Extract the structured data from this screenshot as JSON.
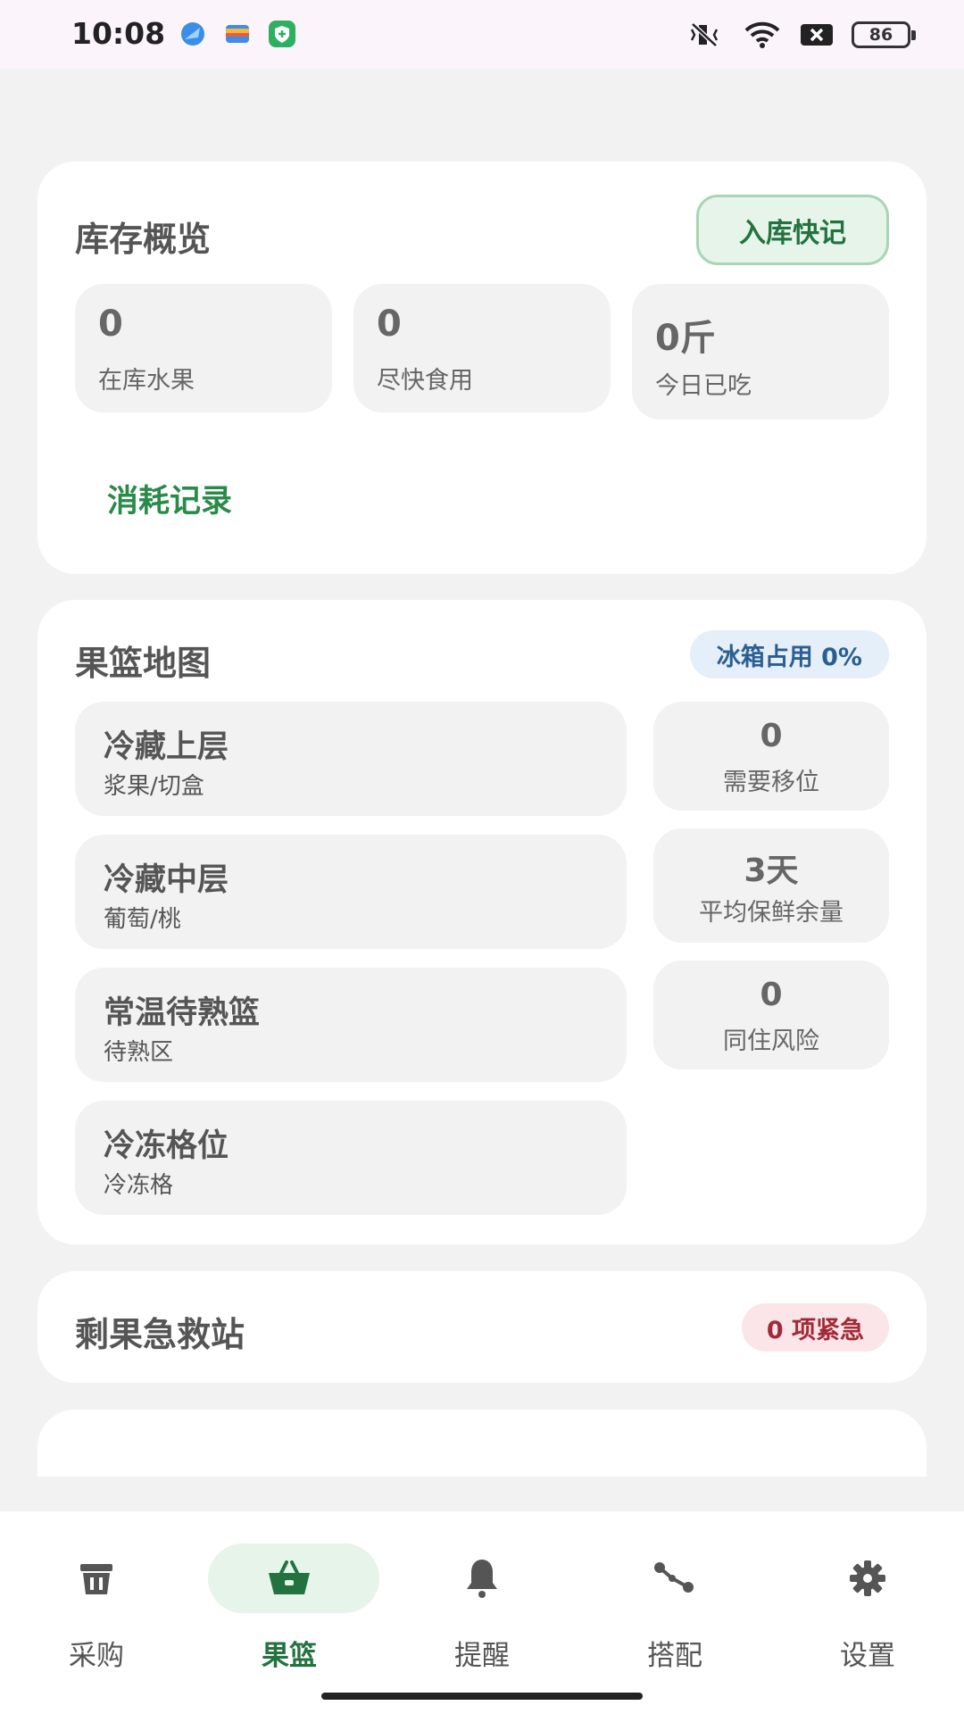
{
  "status_bar": {
    "time": "10:08",
    "battery": "86",
    "icons": [
      "blue-app-icon",
      "wallet-icon",
      "green-shield-app-icon",
      "mute-vibrate-icon",
      "wifi-icon",
      "sim-off-icon",
      "battery-icon"
    ]
  },
  "inventory": {
    "title": "库存概览",
    "quick_in_label": "入库快记",
    "stats": [
      {
        "value": "0",
        "label": "在库水果"
      },
      {
        "value": "0",
        "label": "尽快食用"
      },
      {
        "value": "0斤",
        "label": "今日已吃"
      }
    ],
    "consume_link": "消耗记录"
  },
  "basket_map": {
    "title": "果篮地图",
    "fridge_badge": "冰箱占用 0%",
    "zones": [
      {
        "name": "冷藏上层",
        "desc": "浆果/切盒"
      },
      {
        "name": "冷藏中层",
        "desc": "葡萄/桃"
      },
      {
        "name": "常温待熟篮",
        "desc": "待熟区"
      },
      {
        "name": "冷冻格位",
        "desc": "冷冻格"
      }
    ],
    "side_stats": [
      {
        "value": "0",
        "label": "需要移位"
      },
      {
        "value": "3天",
        "label": "平均保鲜余量"
      },
      {
        "value": "0",
        "label": "同住风险"
      }
    ]
  },
  "rescue": {
    "title": "剩果急救站",
    "urgent_badge": "0 项紧急"
  },
  "colors": {
    "accent_green": "#22733f",
    "badge_blue_bg": "#e5effa",
    "badge_red_bg": "#fbe5e8"
  },
  "nav": {
    "items": [
      {
        "label": "采购",
        "icon": "trash-bin-icon",
        "active": false
      },
      {
        "label": "果篮",
        "icon": "basket-icon",
        "active": true
      },
      {
        "label": "提醒",
        "icon": "bell-icon",
        "active": false
      },
      {
        "label": "搭配",
        "icon": "route-icon",
        "active": false
      },
      {
        "label": "设置",
        "icon": "gear-icon",
        "active": false
      }
    ]
  }
}
